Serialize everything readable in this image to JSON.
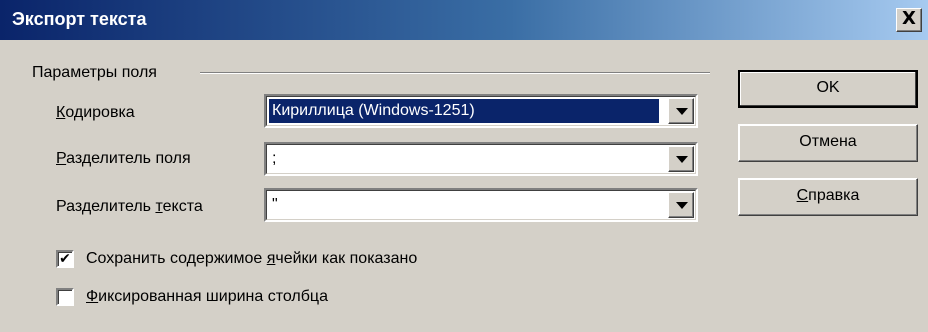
{
  "window": {
    "title": "Экспорт текста",
    "close_glyph": "X"
  },
  "group": {
    "legend": "Параметры поля"
  },
  "fields": [
    {
      "label": "Кодировка",
      "mnemonic": "К",
      "rest": "одировка",
      "value": "Кириллица (Windows-1251)",
      "selected": true
    },
    {
      "label": "Разделитель поля",
      "mnemonic": "Р",
      "rest": "азделитель поля",
      "value": ";"
    },
    {
      "label_pre": "Разделитель ",
      "mnemonic": "т",
      "label_post": "екста",
      "value": "\""
    }
  ],
  "checkboxes": [
    {
      "pre": "Сохранить содержимое ",
      "mnemonic": "я",
      "post": "чейки как показано",
      "checked": true,
      "mark": "✔"
    },
    {
      "pre": "",
      "mnemonic": "Ф",
      "post": "иксированная ширина столбца",
      "checked": false,
      "mark": ""
    }
  ],
  "buttons": {
    "ok": "OK",
    "cancel": "Отмена",
    "help_mnemonic": "С",
    "help_rest": "правка"
  }
}
